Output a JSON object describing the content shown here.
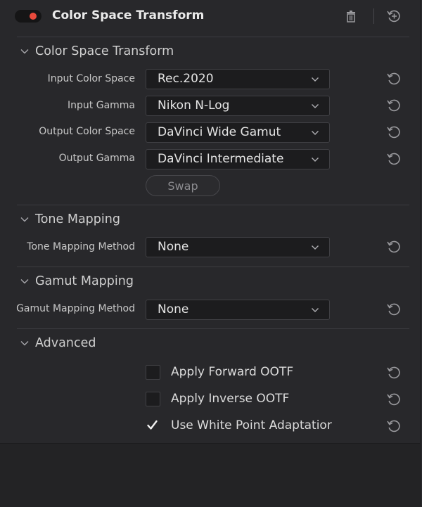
{
  "header": {
    "title": "Color Space Transform",
    "enabled": true,
    "accent": "#e84a3c"
  },
  "sections": {
    "csc": {
      "title": "Color Space Transform",
      "rows": [
        {
          "label": "Input Color Space",
          "value": "Rec.2020"
        },
        {
          "label": "Input Gamma",
          "value": "Nikon N-Log"
        },
        {
          "label": "Output Color Space",
          "value": "DaVinci Wide Gamut"
        },
        {
          "label": "Output Gamma",
          "value": "DaVinci Intermediate"
        }
      ],
      "swap_label": "Swap"
    },
    "tone": {
      "title": "Tone Mapping",
      "label": "Tone Mapping Method",
      "value": "None"
    },
    "gamut": {
      "title": "Gamut Mapping",
      "label": "Gamut Mapping Method",
      "value": "None"
    },
    "advanced": {
      "title": "Advanced",
      "options": [
        {
          "label": "Apply Forward OOTF",
          "checked": false
        },
        {
          "label": "Apply Inverse OOTF",
          "checked": false
        },
        {
          "label": "Use White Point Adaptatior",
          "checked": true
        }
      ]
    }
  },
  "icons": {
    "trash": "trash-icon",
    "header_reset": "reset-plus-icon",
    "reset": "reset-icon",
    "chevron": "chevron-down-icon",
    "check": "checkmark-icon"
  }
}
